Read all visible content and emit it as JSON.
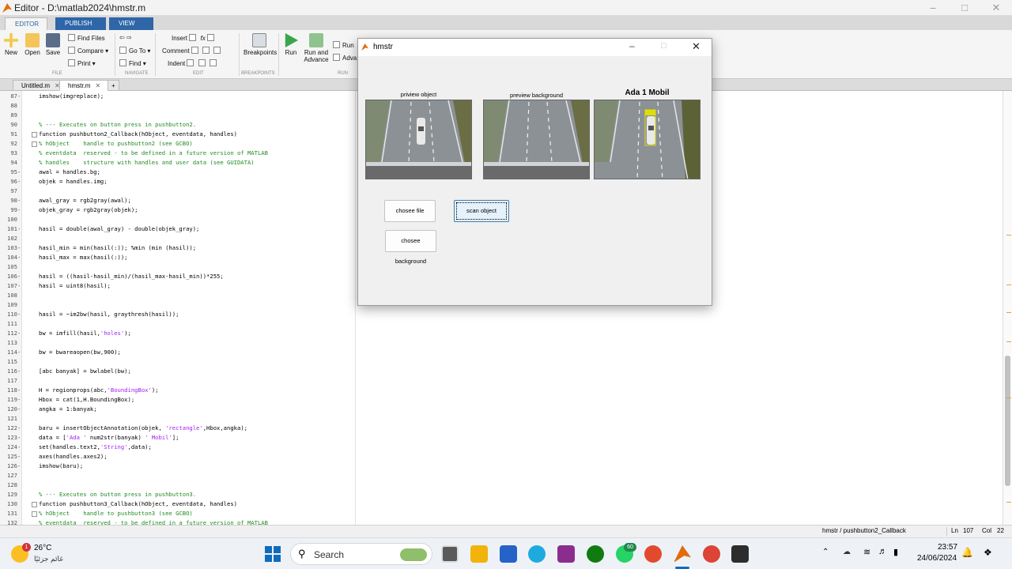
{
  "window_title": "Editor - D:\\matlab2024\\hmstr.m",
  "ribbon_tabs": [
    "EDITOR",
    "PUBLISH",
    "VIEW"
  ],
  "ribbon": {
    "new": "New",
    "open": "Open",
    "save": "Save",
    "find_files": "Find Files",
    "compare": "Compare",
    "print": "Print",
    "go_to": "Go To",
    "find": "Find",
    "insert": "Insert",
    "comment": "Comment",
    "indent": "Indent",
    "breakpoints": "Breakpoints",
    "run": "Run",
    "run_and_advance_1": "Run and",
    "run_and_advance_2": "Advance",
    "run_section": "Run",
    "advance": "Adva",
    "sections": [
      "FILE",
      "NAVIGATE",
      "EDIT",
      "BREAKPOINTS",
      "RUN"
    ]
  },
  "doc_tabs": [
    "Untitled.m",
    "hmstr.m"
  ],
  "code_lines": [
    {
      "n": "87",
      "d": "-",
      "t": "imshow(imgreplace);",
      "c": false
    },
    {
      "n": "88",
      "d": "",
      "t": "",
      "c": false
    },
    {
      "n": "89",
      "d": "",
      "t": "",
      "c": false
    },
    {
      "n": "90",
      "d": "",
      "t": "% --- Executes on button press in pushbutton2.",
      "c": true
    },
    {
      "n": "91",
      "d": "",
      "t": "function pushbutton2_Callback(hObject, eventdata, handles)",
      "c": false
    },
    {
      "n": "92",
      "d": "",
      "t": "% hObject    handle to pushbutton2 (see GCBO)",
      "c": true
    },
    {
      "n": "93",
      "d": "",
      "t": "% eventdata  reserved - to be defined in a future version of MATLAB",
      "c": true
    },
    {
      "n": "94",
      "d": "",
      "t": "% handles    structure with handles and user data (see GUIDATA)",
      "c": true
    },
    {
      "n": "95",
      "d": "-",
      "t": "awal = handles.bg;",
      "c": false
    },
    {
      "n": "96",
      "d": "-",
      "t": "objek = handles.img;",
      "c": false
    },
    {
      "n": "97",
      "d": "",
      "t": "",
      "c": false
    },
    {
      "n": "98",
      "d": "-",
      "t": "awal_gray = rgb2gray(awal);",
      "c": false
    },
    {
      "n": "99",
      "d": "-",
      "t": "objek_gray = rgb2gray(objek);",
      "c": false
    },
    {
      "n": "100",
      "d": "",
      "t": "",
      "c": false
    },
    {
      "n": "101",
      "d": "-",
      "t": "hasil = double(awal_gray) - double(objek_gray);",
      "c": false
    },
    {
      "n": "102",
      "d": "",
      "t": "",
      "c": false
    },
    {
      "n": "103",
      "d": "-",
      "t": "hasil_min = min(hasil(:)); %min (min (hasil));",
      "c": false
    },
    {
      "n": "104",
      "d": "-",
      "t": "hasil_max = max(hasil(:));",
      "c": false
    },
    {
      "n": "105",
      "d": "",
      "t": "",
      "c": false
    },
    {
      "n": "106",
      "d": "-",
      "t": "hasil = ((hasil-hasil_min)/(hasil_max-hasil_min))*255;",
      "c": false
    },
    {
      "n": "107",
      "d": "-",
      "t": "hasil = uint8(hasil);",
      "c": false
    },
    {
      "n": "108",
      "d": "",
      "t": "",
      "c": false
    },
    {
      "n": "109",
      "d": "",
      "t": "",
      "c": false
    },
    {
      "n": "110",
      "d": "-",
      "t": "hasil = ~im2bw(hasil, graythresh(hasil));",
      "c": false
    },
    {
      "n": "111",
      "d": "",
      "t": "",
      "c": false
    },
    {
      "n": "112",
      "d": "-",
      "t": "bw = imfill(hasil,'holes');",
      "c": false
    },
    {
      "n": "113",
      "d": "",
      "t": "",
      "c": false
    },
    {
      "n": "114",
      "d": "-",
      "t": "bw = bwareaopen(bw,900);",
      "c": false
    },
    {
      "n": "115",
      "d": "",
      "t": "",
      "c": false
    },
    {
      "n": "116",
      "d": "-",
      "t": "[abc banyak] = bwlabel(bw);",
      "c": false
    },
    {
      "n": "117",
      "d": "",
      "t": "",
      "c": false
    },
    {
      "n": "118",
      "d": "-",
      "t": "H = regionprops(abc,'BoundingBox');",
      "c": false
    },
    {
      "n": "119",
      "d": "-",
      "t": "Hbox = cat(1,H.BoundingBox);",
      "c": false
    },
    {
      "n": "120",
      "d": "-",
      "t": "angka = 1:banyak;",
      "c": false
    },
    {
      "n": "121",
      "d": "",
      "t": "",
      "c": false
    },
    {
      "n": "122",
      "d": "-",
      "t": "baru = insertObjectAnnotation(objek, 'rectangle',Hbox,angka);",
      "c": false
    },
    {
      "n": "123",
      "d": "-",
      "t": "data = ['Ada ' num2str(banyak) ' Mobil'];",
      "c": false
    },
    {
      "n": "124",
      "d": "-",
      "t": "set(handles.text2,'String',data);",
      "c": false
    },
    {
      "n": "125",
      "d": "-",
      "t": "axes(handles.axes2);",
      "c": false
    },
    {
      "n": "126",
      "d": "-",
      "t": "imshow(baru);",
      "c": false
    },
    {
      "n": "127",
      "d": "",
      "t": "",
      "c": false
    },
    {
      "n": "128",
      "d": "",
      "t": "",
      "c": false
    },
    {
      "n": "129",
      "d": "",
      "t": "% --- Executes on button press in pushbutton3.",
      "c": true
    },
    {
      "n": "130",
      "d": "",
      "t": "function pushbutton3_Callback(hObject, eventdata, handles)",
      "c": false
    },
    {
      "n": "131",
      "d": "",
      "t": "% hObject    handle to pushbutton3 (see GCBO)",
      "c": true
    },
    {
      "n": "132",
      "d": "",
      "t": "% eventdata  reserved - to be defined in a future version of MATLAB",
      "c": true
    }
  ],
  "status": {
    "function": "hmstr / pushbutton2_Callback",
    "ln_label": "Ln",
    "ln": "107",
    "col_label": "Col",
    "col": "22"
  },
  "figure": {
    "title": "hmstr",
    "preview_object_label": "priview object",
    "preview_background_label": "preview background",
    "result_label": "Ada 1 Mobil",
    "choose_file": "chosee file",
    "choose_background": "chosee background",
    "scan_object": "scan object"
  },
  "taskbar": {
    "temperature": "26°C",
    "weather_text": "غائم جزئيًا",
    "weather_badge": "1",
    "search": "Search",
    "whatsapp_badge": "60",
    "time": "23:57",
    "date": "24/06/2024"
  },
  "colors": {
    "accent": "#2e66a8",
    "highlight": "#fbe3a6",
    "comment": "#228b22",
    "string": "#a020f0"
  }
}
